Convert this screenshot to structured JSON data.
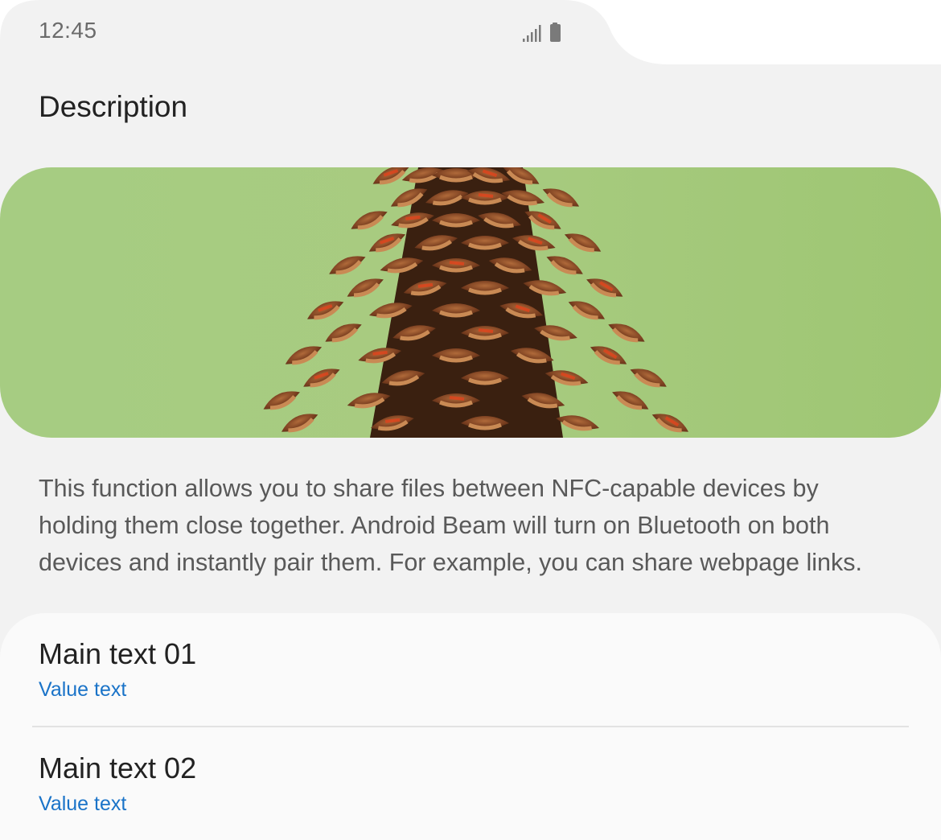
{
  "status_bar": {
    "time": "12:45",
    "icons": [
      "signal-icon",
      "battery-icon"
    ]
  },
  "header": {
    "title": "Description"
  },
  "hero": {
    "image": "pine-cone-image"
  },
  "description": {
    "text": "This function allows you to share files between NFC-capable devices by\nholding them close together. Android Beam will  turn on Bluetooth on both\ndevices and instantly pair them. For example, you can share webpage links."
  },
  "list": {
    "items": [
      {
        "main": "Main text 01",
        "value": "Value text"
      },
      {
        "main": "Main text 02",
        "value": "Value text"
      }
    ]
  },
  "colors": {
    "background": "#f2f2f2",
    "card": "#fafafa",
    "accent": "#1a73c8",
    "hero_green": "#a4c97c"
  }
}
